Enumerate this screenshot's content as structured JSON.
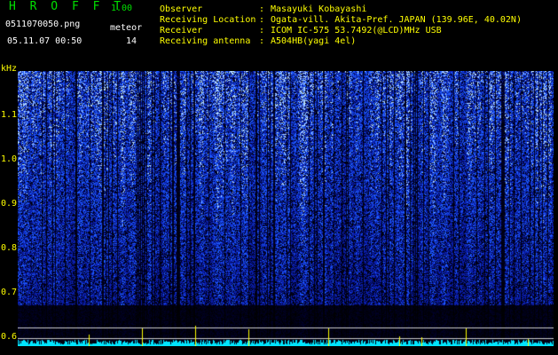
{
  "header": {
    "app_title": "H R O F F T",
    "app_version": "1.00",
    "filename": "0511070050.png",
    "datetime": "05.11.07 00:50",
    "meteor_label": "meteor",
    "meteor_count": "14"
  },
  "info": [
    {
      "label": "Observer",
      "value": "Masayuki Kobayashi"
    },
    {
      "label": "Receiving Location",
      "value": "Ogata-vill. Akita-Pref. JAPAN (139.96E, 40.02N)"
    },
    {
      "label": "Receiver",
      "value": "ICOM IC-575 53.7492(@LCD)MHz USB"
    },
    {
      "label": "Receiving antenna",
      "value": "A504HB(yagi 4el)"
    }
  ],
  "info_separator": ":",
  "spectrogram": {
    "y_unit": "kHz",
    "y_ticks": [
      "1.1",
      "1.0",
      "0.9",
      "0.8",
      "0.7",
      "0.6"
    ],
    "x_ticks": [
      "0051",
      "0052",
      "0053",
      "0054",
      "0055",
      "0056",
      "0057",
      "0058",
      "0059",
      "0100"
    ],
    "colors": {
      "background": "#000000",
      "signal": "#1a3cff",
      "axis": "#ffff00",
      "header": "#00e000"
    }
  }
}
